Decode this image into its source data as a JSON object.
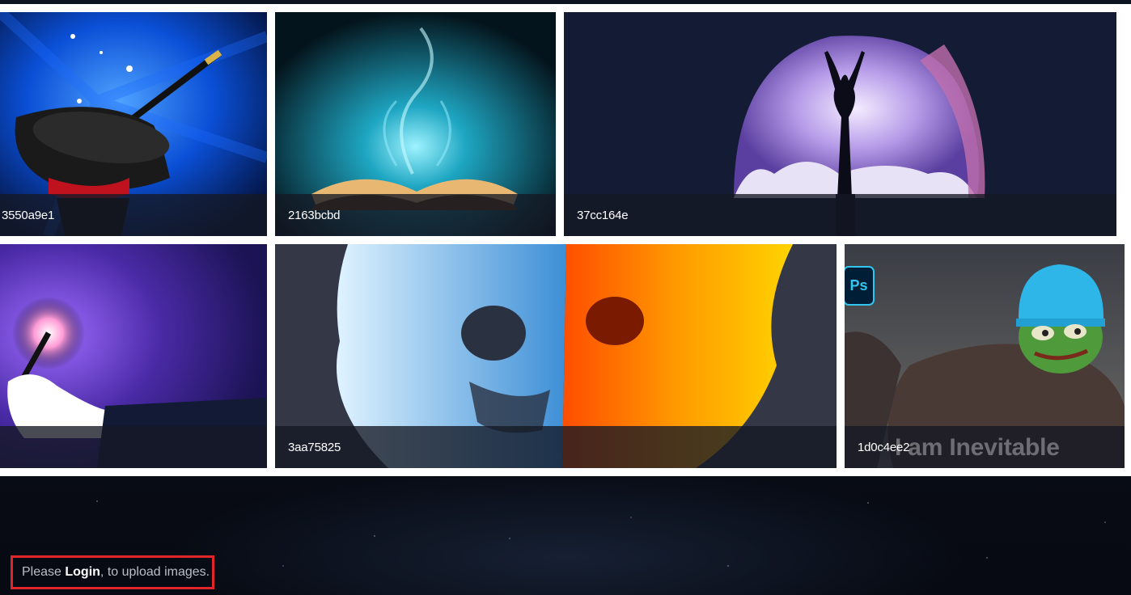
{
  "tiles": [
    {
      "caption": "3550a9e1",
      "image": "magic-hat-wand"
    },
    {
      "caption": "2163bcbd",
      "image": "glowing-book"
    },
    {
      "caption": "37cc164e",
      "image": "cave-silhouette"
    },
    {
      "caption": "",
      "image": "magic-wand-sparkle"
    },
    {
      "caption": "3aa75825",
      "image": "fire-ice-skull"
    },
    {
      "caption": "1d0c4ee2",
      "image": "pepe-thanos",
      "badge": "Ps",
      "overlay_text": "I am Inevitable"
    }
  ],
  "footer": {
    "prefix": "Please ",
    "login_link": "Login",
    "suffix": ", to upload images."
  },
  "colors": {
    "highlight_border": "#e0262b",
    "caption_bg": "rgba(20,24,36,0.78)"
  }
}
